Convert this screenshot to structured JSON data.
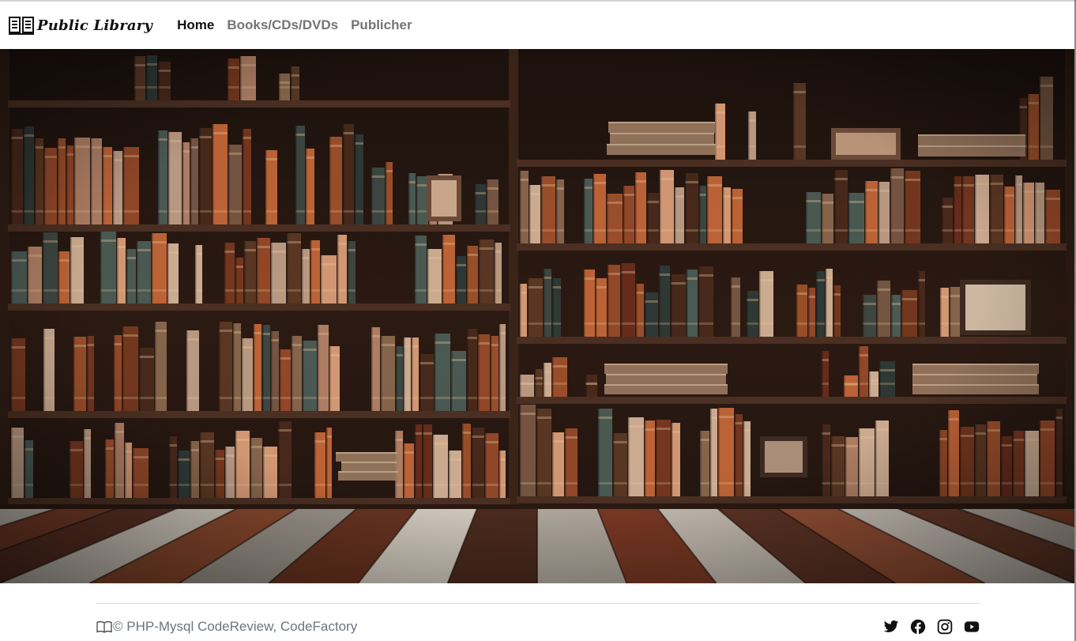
{
  "navbar": {
    "brand": {
      "name": "Public Library",
      "icon": "book-icon"
    },
    "links": [
      {
        "label": "Home",
        "active": true
      },
      {
        "label": "Books/CDs/DVDs",
        "active": false
      },
      {
        "label": "Publicher",
        "active": false
      }
    ]
  },
  "hero": {
    "image": "library-bookshelves-photo"
  },
  "footer": {
    "copyright": "© PHP-Mysql CodeReview, CodeFactory",
    "copyright_icon": "open-book-icon",
    "social": [
      {
        "icon": "twitter-icon"
      },
      {
        "icon": "facebook-icon"
      },
      {
        "icon": "instagram-icon"
      },
      {
        "icon": "youtube-icon"
      }
    ]
  },
  "colors": {
    "nav_active": "#111111",
    "nav_muted": "#6f6f6f",
    "footer_text": "#6c757d"
  }
}
